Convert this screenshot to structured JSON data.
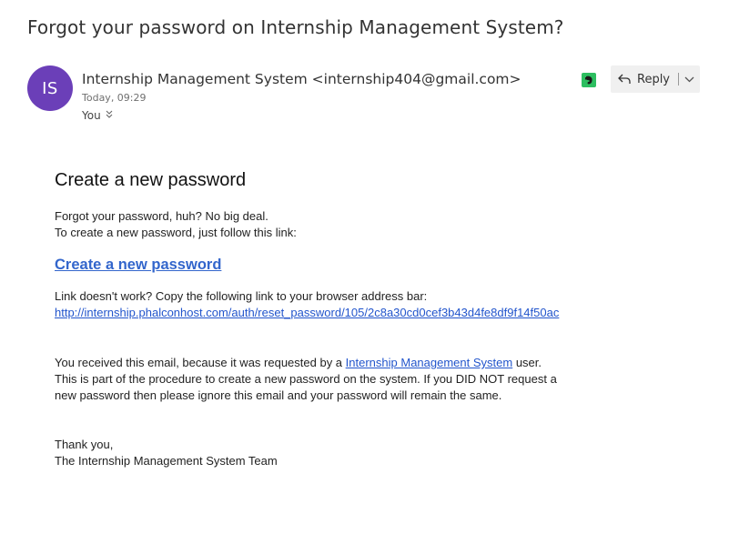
{
  "email": {
    "subject": "Forgot your password on Internship Management System?",
    "avatar_initials": "IS",
    "sender": "Internship Management System <internship404@gmail.com>",
    "time": "Today, 09:29",
    "recipient": "You"
  },
  "toolbar": {
    "reply_label": "Reply",
    "evernote_icon": "evernote-icon"
  },
  "message": {
    "heading": "Create a new password",
    "intro_line1": "Forgot your password, huh? No big deal.",
    "intro_line2": "To create a new password, just follow this link:",
    "cta_label": "Create a new password",
    "fallback_text": "Link doesn't work? Copy the following link to your browser address bar:",
    "reset_url": "http://internship.phalconhost.com/auth/reset_password/105/2c8a30cd0cef3b43d4fe8df9f14f50ac",
    "reason_prefix": "You received this email, because it was requested by a ",
    "reason_link": "Internship Management System",
    "reason_suffix": " user.",
    "reason_line2": "This is part of the procedure to create a new password on the system. If you DID NOT request a",
    "reason_line3": "new password then please ignore this email and your password will remain the same.",
    "signoff": "Thank you,",
    "team": "The Internship Management System Team"
  },
  "colors": {
    "avatar_bg": "#6b3fb8",
    "link": "#2255cc",
    "evernote": "#2dbe60"
  }
}
